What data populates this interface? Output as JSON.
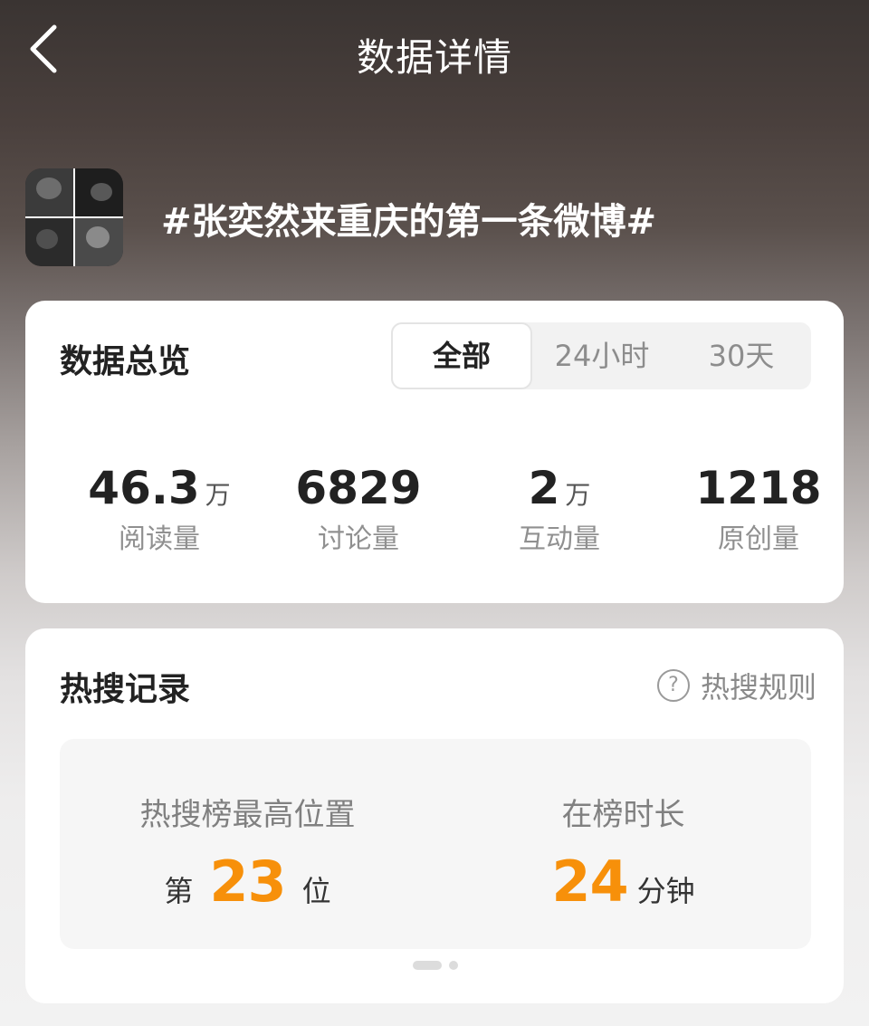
{
  "header": {
    "title": "数据详情"
  },
  "topic": {
    "title": "#张奕然来重庆的第一条微博#"
  },
  "overview": {
    "heading": "数据总览",
    "tabs": [
      {
        "label": "全部",
        "active": true
      },
      {
        "label": "24小时",
        "active": false
      },
      {
        "label": "30天",
        "active": false
      }
    ],
    "stats": [
      {
        "value": "46.3",
        "unit": "万",
        "label": "阅读量"
      },
      {
        "value": "6829",
        "unit": "",
        "label": "讨论量"
      },
      {
        "value": "2",
        "unit": "万",
        "label": "互动量"
      },
      {
        "value": "1218",
        "unit": "",
        "label": "原创量"
      }
    ]
  },
  "hot_search": {
    "heading": "热搜记录",
    "rules_label": "热搜规则",
    "peak": {
      "label": "热搜榜最高位置",
      "prefix": "第",
      "value": "23",
      "suffix": "位"
    },
    "duration": {
      "label": "在榜时长",
      "value": "24",
      "suffix": "分钟"
    }
  },
  "colors": {
    "accent": "#f7900a"
  },
  "icons": {
    "back": "chevron-left-icon",
    "help": "question-circle-icon"
  }
}
